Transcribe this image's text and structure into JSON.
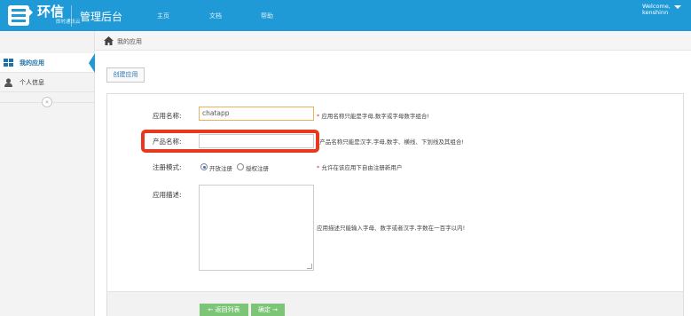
{
  "header": {
    "brand": "环信",
    "brand_sub": "即时通讯云",
    "admin_title": "管理后台",
    "nav": [
      {
        "label": "主页"
      },
      {
        "label": "文档"
      },
      {
        "label": "帮助"
      }
    ],
    "welcome": "Welcome,",
    "username": "kenshinn"
  },
  "sidebar": {
    "items": [
      {
        "label": "我的应用",
        "icon": "apps-icon",
        "active": true
      },
      {
        "label": "个人信息",
        "icon": "user-icon",
        "active": false
      }
    ],
    "collapse_glyph": "«"
  },
  "breadcrumb": {
    "label": "我的应用",
    "icon": "home-icon"
  },
  "toolbar": {
    "create_label": "创建应用"
  },
  "form": {
    "app_name": {
      "label": "应用名称:",
      "value": "chatapp",
      "hint_required": "*",
      "hint": "应用名称只能是字母,数字或字母数字组合!"
    },
    "product_name": {
      "label": "产品名称:",
      "value": "",
      "hint_required": "*",
      "hint": "产品名称只能是汉字,字母,数字、横线、下划线及其组合!"
    },
    "register_mode": {
      "label": "注册模式:",
      "options": [
        {
          "label": "开放注册",
          "checked": true
        },
        {
          "label": "授权注册",
          "checked": false
        }
      ],
      "hint_required": "*",
      "hint": "允许在该应用下自由注册新用户"
    },
    "description": {
      "label": "应用描述:",
      "value": "",
      "hint": "应用描述只能输入字母、数字或者汉字,字数在一百字以内!"
    }
  },
  "actions": {
    "back_label": "← 返回列表",
    "next_label": "确定 →"
  },
  "colors": {
    "topbar": "#1f9ad6",
    "highlight": "#e8391f",
    "button_green": "#7cc576",
    "required": "#e03020"
  }
}
